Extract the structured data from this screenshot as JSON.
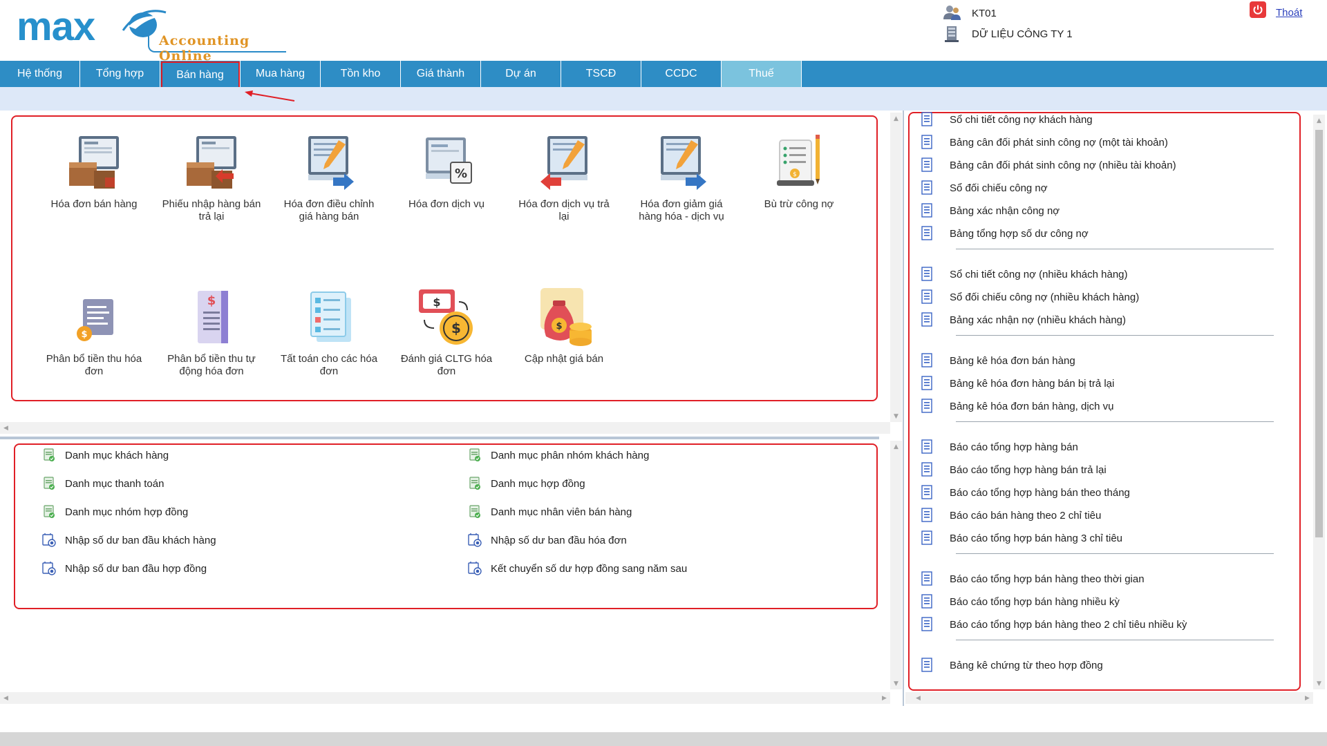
{
  "header": {
    "logo_main": "max",
    "logo_sub": "Accounting Online",
    "user_code": "KT01",
    "company": "DỮ LIỆU CÔNG TY 1",
    "logout_label": "Thoát"
  },
  "nav": {
    "items": [
      "Hệ thống",
      "Tổng hợp",
      "Bán hàng",
      "Mua hàng",
      "Tồn kho",
      "Giá thành",
      "Dự án",
      "TSCĐ",
      "CCDC",
      "Thuế"
    ],
    "active": "Thuế",
    "highlighted": "Bán hàng"
  },
  "functions": [
    {
      "label": "Hóa đơn bán hàng",
      "icon": "invoice-box-icon"
    },
    {
      "label": "Phiếu nhập hàng bán trả lại",
      "icon": "invoice-return-box-icon"
    },
    {
      "label": "Hóa đơn điều chỉnh giá hàng bán",
      "icon": "invoice-adjust-icon"
    },
    {
      "label": "Hóa đơn dịch vụ",
      "icon": "invoice-percent-icon"
    },
    {
      "label": "Hóa đơn dịch vụ trả lại",
      "icon": "invoice-service-return-icon"
    },
    {
      "label": "Hóa đơn giảm giá hàng hóa - dịch vụ",
      "icon": "invoice-discount-icon"
    },
    {
      "label": "Bù trừ công nợ",
      "icon": "debt-offset-icon"
    },
    {
      "label": "Phân bổ tiền thu hóa đơn",
      "icon": "allocate-receipt-icon"
    },
    {
      "label": "Phân bổ tiền thu tự động hóa đơn",
      "icon": "auto-allocate-icon"
    },
    {
      "label": "Tất toán cho các hóa đơn",
      "icon": "settle-invoices-icon"
    },
    {
      "label": "Đánh giá CLTG hóa đơn",
      "icon": "exchange-rate-icon"
    },
    {
      "label": "Cập nhật giá bán",
      "icon": "money-bag-icon"
    }
  ],
  "catalog": [
    {
      "label": "Danh mục khách hàng",
      "icon": "catalog-icon"
    },
    {
      "label": "Danh mục phân nhóm khách hàng",
      "icon": "catalog-icon"
    },
    {
      "label": "Danh mục thanh toán",
      "icon": "catalog-icon"
    },
    {
      "label": "Danh mục hợp đồng",
      "icon": "catalog-icon"
    },
    {
      "label": "Danh mục nhóm hợp đồng",
      "icon": "catalog-icon"
    },
    {
      "label": "Danh mục nhân viên bán hàng",
      "icon": "catalog-icon"
    },
    {
      "label": "Nhập số dư ban đầu khách hàng",
      "icon": "opening-balance-icon"
    },
    {
      "label": "Nhập số dư ban đầu hóa đơn",
      "icon": "opening-balance-icon"
    },
    {
      "label": "Nhập số dư ban đầu hợp đồng",
      "icon": "opening-balance-icon"
    },
    {
      "label": "Kết chuyển số dư hợp đồng sang năm sau",
      "icon": "opening-balance-icon"
    }
  ],
  "reports": [
    [
      "Sổ chi tiết công nợ khách hàng",
      "Bảng cân đối phát sinh công nợ (một tài khoản)",
      "Bảng cân đối phát sinh công nợ (nhiều tài khoản)",
      "Sổ đối chiếu công nợ",
      "Bảng xác nhận công nợ",
      "Bảng tổng hợp số dư công nợ"
    ],
    [
      "Sổ chi tiết công nợ (nhiều khách hàng)",
      "Sổ đối chiếu công nợ (nhiều khách hàng)",
      "Bảng xác nhận nợ (nhiều khách hàng)"
    ],
    [
      "Bảng kê hóa đơn bán hàng",
      "Bảng kê hóa đơn hàng bán bị trả lại",
      "Bảng kê hóa đơn bán hàng, dịch vụ"
    ],
    [
      "Báo cáo tổng hợp hàng bán",
      "Báo cáo tổng hợp hàng bán trả lại",
      "Báo cáo tổng hợp hàng bán theo tháng",
      "Báo cáo bán hàng theo 2 chỉ tiêu",
      "Báo cáo tổng hợp bán hàng 3 chỉ tiêu"
    ],
    [
      "Báo cáo tổng hợp bán hàng theo thời gian",
      "Báo cáo tổng hợp bán hàng nhiều kỳ",
      "Báo cáo tổng hợp bán hàng theo 2 chỉ tiêu nhiều kỳ"
    ],
    [
      "Bảng kê chứng từ theo hợp đồng"
    ]
  ],
  "colors": {
    "nav_bg": "#2e8dc5",
    "nav_active": "#7bc3de",
    "annotation_red": "#e01f26",
    "subbar": "#dde8f8"
  }
}
